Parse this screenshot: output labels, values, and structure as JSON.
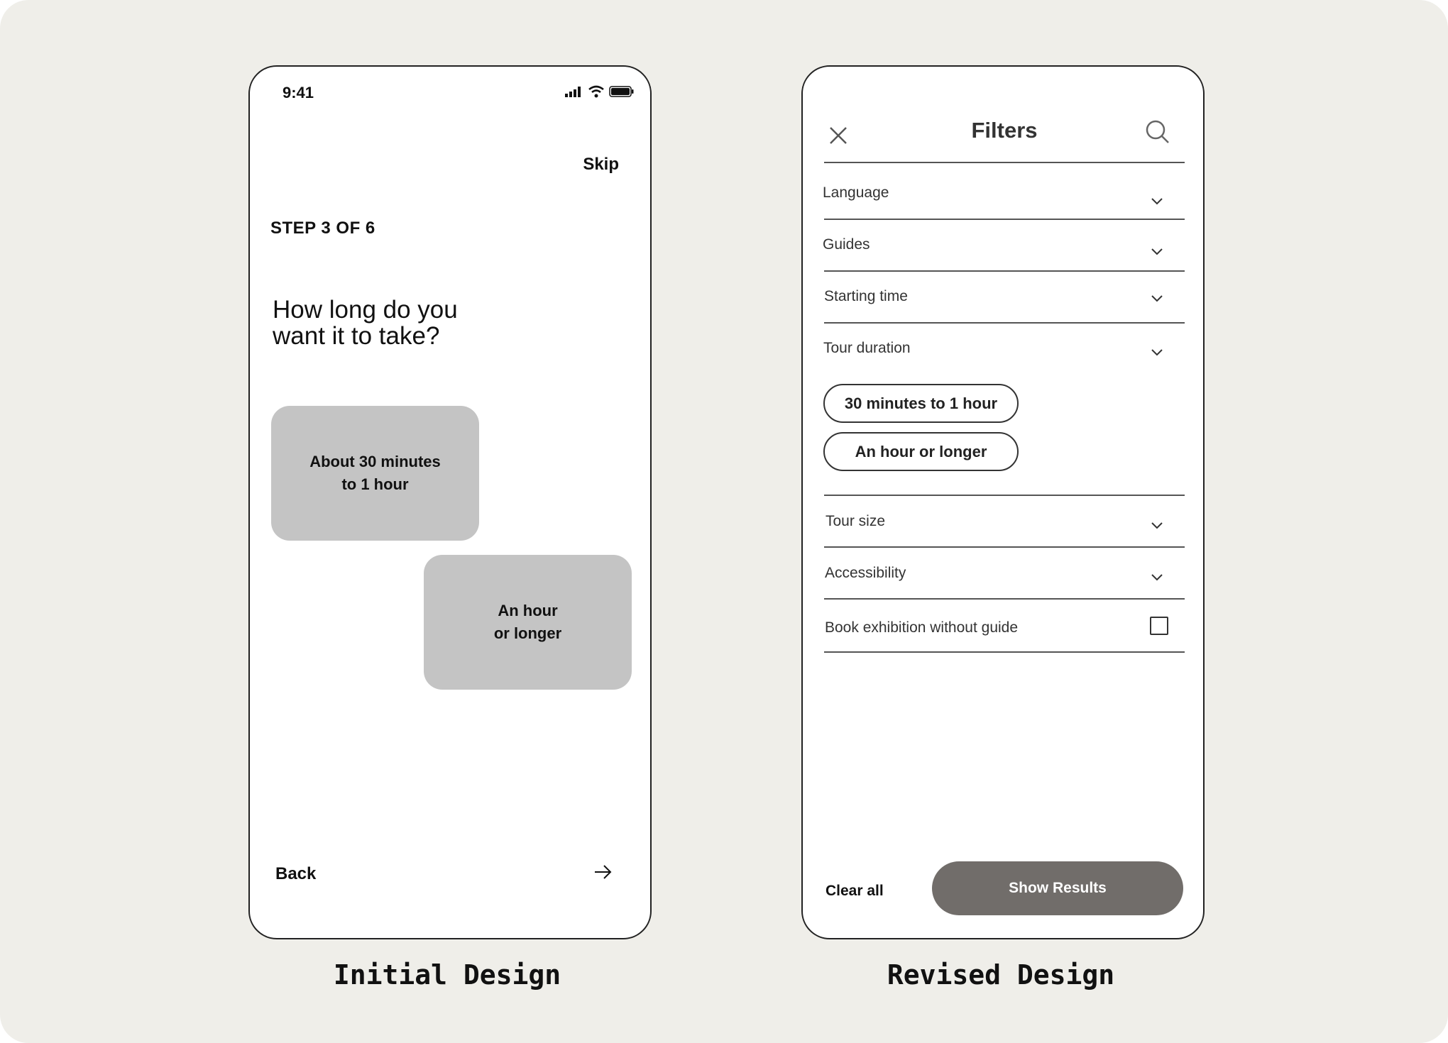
{
  "initial": {
    "caption": "Initial Design",
    "status_time": "9:41",
    "skip_label": "Skip",
    "step_label": "STEP 3 OF 6",
    "question": "How long do you want it to take?",
    "options": [
      {
        "label": "About 30 minutes\nto 1 hour"
      },
      {
        "label": "An hour\nor longer"
      }
    ],
    "back_label": "Back"
  },
  "revised": {
    "caption": "Revised Design",
    "title": "Filters",
    "rows": [
      {
        "label": "Language"
      },
      {
        "label": "Guides"
      },
      {
        "label": "Starting time"
      },
      {
        "label": "Tour duration"
      },
      {
        "label": "Tour size"
      },
      {
        "label": "Accessibility"
      },
      {
        "label": "Book exhibition without guide"
      }
    ],
    "duration_chips": [
      "30 minutes to 1 hour",
      "An hour or longer"
    ],
    "checkbox_checked": false,
    "clear_all_label": "Clear all",
    "show_results_label": "Show Results",
    "colors": {
      "background": "#efeee9",
      "option_fill": "#c4c4c4",
      "primary_button": "#716d6a"
    }
  }
}
